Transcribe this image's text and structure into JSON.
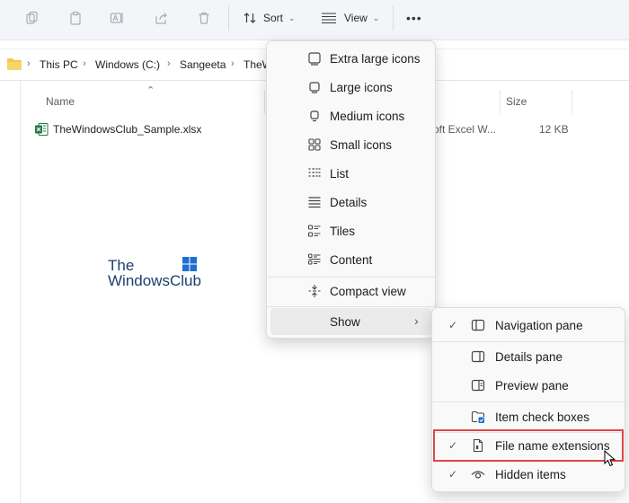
{
  "toolbar": {
    "sort_label": "Sort",
    "view_label": "View",
    "more_label": "•••"
  },
  "breadcrumb": [
    "This PC",
    "Windows (C:)",
    "Sangeeta",
    "TheW"
  ],
  "columns": {
    "name": "Name",
    "type_partial": "",
    "size": "Size"
  },
  "files": [
    {
      "name": "TheWindowsClub_Sample.xlsx",
      "type": "oft Excel W...",
      "size": "12 KB"
    }
  ],
  "watermark": {
    "line1": "The",
    "line2": "WindowsClub"
  },
  "view_menu": {
    "items": [
      {
        "label": "Extra large icons",
        "icon": "extra-large-icons-icon"
      },
      {
        "label": "Large icons",
        "icon": "large-icons-icon"
      },
      {
        "label": "Medium icons",
        "icon": "medium-icons-icon"
      },
      {
        "label": "Small icons",
        "icon": "small-icons-icon"
      },
      {
        "label": "List",
        "icon": "list-icon"
      },
      {
        "label": "Details",
        "icon": "details-icon"
      },
      {
        "label": "Tiles",
        "icon": "tiles-icon"
      },
      {
        "label": "Content",
        "icon": "content-icon"
      },
      {
        "label": "Compact view",
        "icon": "compact-view-icon"
      },
      {
        "label": "Show",
        "icon": "chevron-right-icon"
      }
    ]
  },
  "show_menu": {
    "items": [
      {
        "label": "Navigation pane",
        "checked": true,
        "icon": "navigation-pane-icon"
      },
      {
        "label": "Details pane",
        "checked": false,
        "icon": "details-pane-icon"
      },
      {
        "label": "Preview pane",
        "checked": false,
        "icon": "preview-pane-icon"
      },
      {
        "label": "Item check boxes",
        "checked": false,
        "icon": "item-check-boxes-icon"
      },
      {
        "label": "File name extensions",
        "checked": true,
        "icon": "file-name-extensions-icon"
      },
      {
        "label": "Hidden items",
        "checked": true,
        "icon": "hidden-items-icon"
      }
    ],
    "check_glyph": "✓",
    "highlight_color": "#e04646"
  }
}
